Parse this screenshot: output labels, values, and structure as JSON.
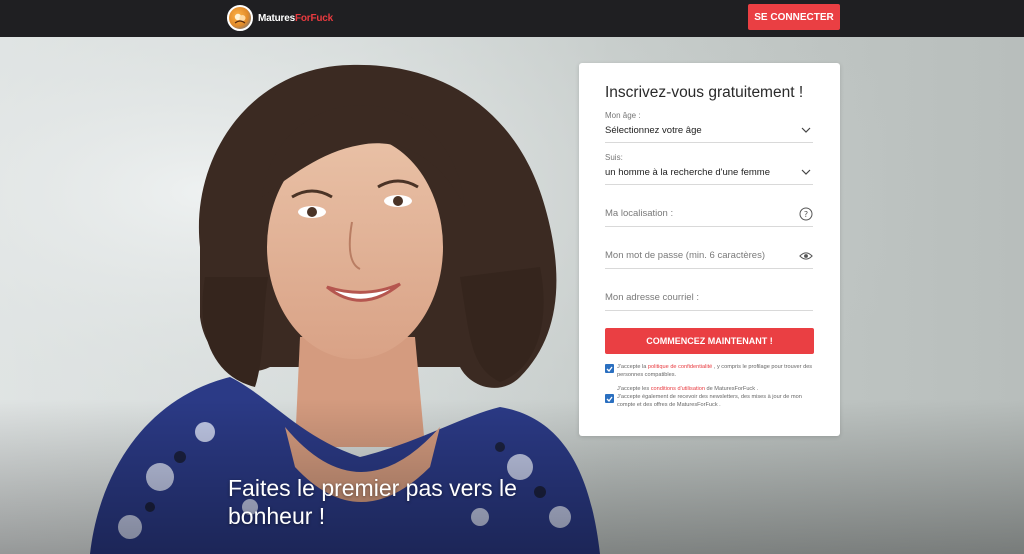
{
  "header": {
    "logo_part1": "Matures",
    "logo_part2": "ForFuck",
    "login_button": "SE CONNECTER"
  },
  "hero": {
    "tagline": "Faites le premier pas vers le bonheur !"
  },
  "form": {
    "title": "Inscrivez-vous gratuitement !",
    "age": {
      "label": "Mon âge :",
      "value": "Sélectionnez votre âge"
    },
    "seeking": {
      "label": "Suis:",
      "value": "un homme à la recherche d'une femme"
    },
    "location": {
      "placeholder": "Ma localisation :"
    },
    "password": {
      "placeholder": "Mon mot de passe (min. 6 caractères)"
    },
    "email": {
      "placeholder": "Mon adresse courriel :"
    },
    "submit_label": "COMMENCEZ MAINTENANT !",
    "consent1": {
      "before": "J'accepte la ",
      "link": "politique de confidentialité",
      "after": " , y compris le profilage pour trouver des personnes compatibles."
    },
    "consent2": {
      "before": "J'accepte les ",
      "link": "conditions d'utilisation",
      "after": " de MaturesForFuck .",
      "extra": "J'accepte également de recevoir des newsletters, des mises à jour de mon compte et des offres de MaturesForFuck ."
    }
  },
  "colors": {
    "accent": "#ea3f43",
    "header_bg": "#1f1f22",
    "checkbox": "#2a6fc0"
  }
}
